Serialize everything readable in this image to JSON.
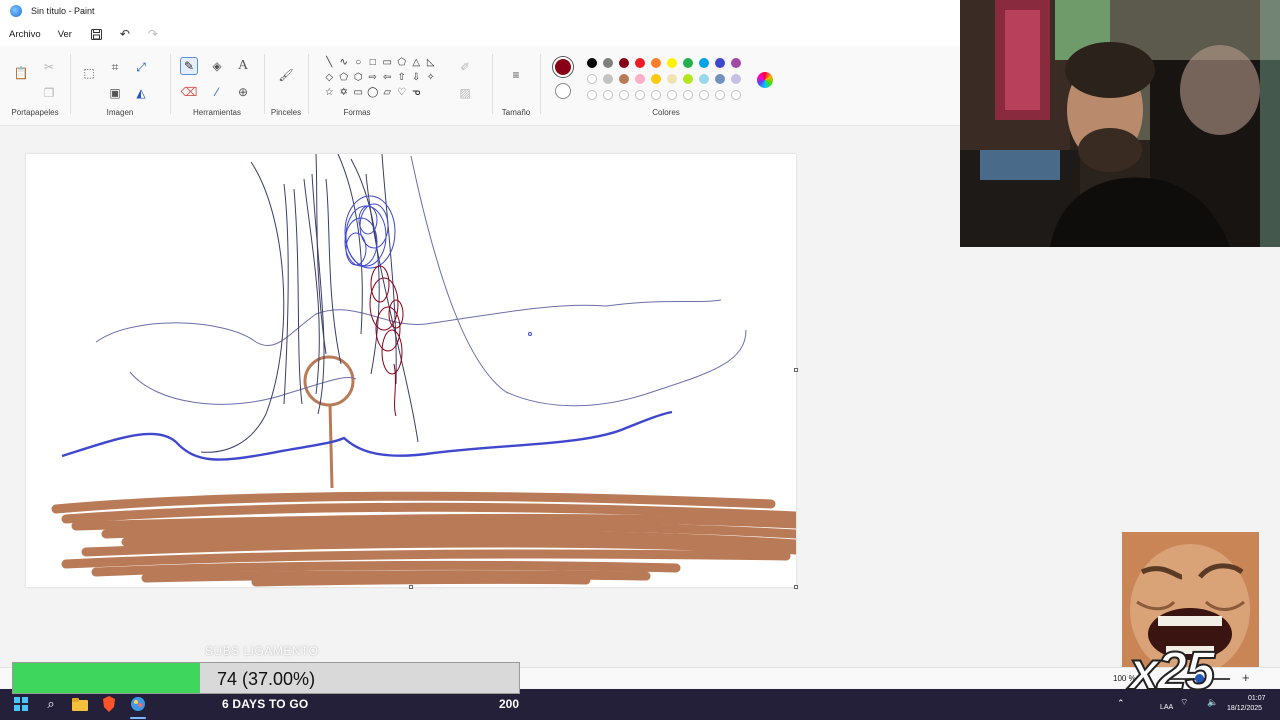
{
  "window": {
    "title": "Sin título - Paint"
  },
  "menu": {
    "file": "Archivo",
    "view": "Ver"
  },
  "ribbon": {
    "groups": {
      "clipboard": "Portapapeles",
      "image": "Imagen",
      "tools": "Herramientas",
      "brushes": "Pinceles",
      "shapes": "Formas",
      "size": "Tamaño",
      "colors": "Colores"
    },
    "shape_glyphs": [
      "╲",
      "∿",
      "○",
      "□",
      "▭",
      "⬠",
      "△",
      "◺",
      "◇",
      "⬠",
      "⬡",
      "⇨",
      "⇦",
      "⇧",
      "⇩",
      "✧",
      "☆",
      "✡",
      "▭",
      "◯",
      "▱",
      "♡",
      "ᓀ",
      ""
    ],
    "palette_row1": [
      "#000000",
      "#7f7f7f",
      "#880015",
      "#ed1c24",
      "#ff7f27",
      "#fff200",
      "#22b14c",
      "#00a2e8",
      "#3f48cc",
      "#a349a4"
    ],
    "palette_row2": [
      "#ffffff",
      "#c3c3c3",
      "#b97a57",
      "#ffaec9",
      "#ffc90e",
      "#efe4b0",
      "#b5e61d",
      "#99d9ea",
      "#7092be",
      "#c8bfe7"
    ],
    "primary_color": "#880015",
    "secondary_color": "#ffffff"
  },
  "overlay": {
    "goal_caption": "SUBS LIGAMENTO",
    "goal_text": "74 (37.00%)",
    "goal_progress_percent": 37,
    "countdown": "6 DAYS TO GO",
    "goal_target": "200",
    "multiplier": "x25"
  },
  "status": {
    "zoom": "100 %"
  },
  "tray": {
    "lang": "LAA",
    "time": "01:07",
    "date": "18/12/2025"
  }
}
